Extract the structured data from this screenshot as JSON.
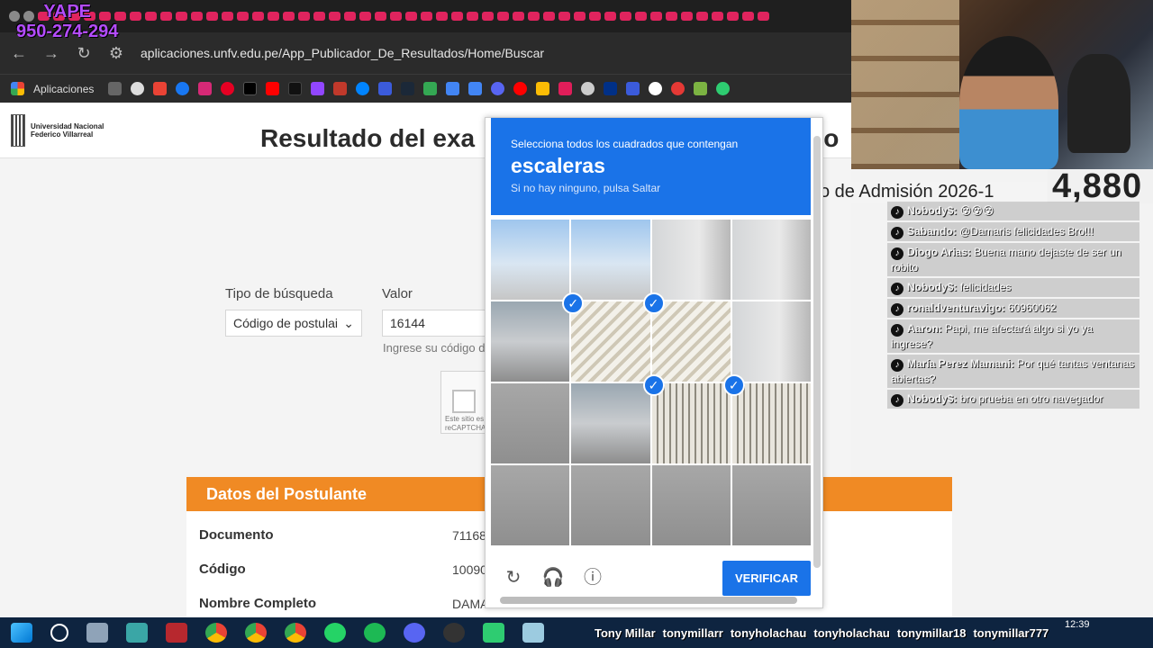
{
  "overlay": {
    "yape_label": "YAPE",
    "yape_number": "950-274-294"
  },
  "browser": {
    "url": "aplicaciones.unfv.edu.pe/App_Publicador_De_Resultados/Home/Buscar",
    "apps_label": "Aplicaciones"
  },
  "page": {
    "logo_line1": "Universidad Nacional",
    "logo_line2": "Federico Villarreal",
    "title_left": "Resultado del exa",
    "title_right": "ario",
    "process_text": "so de Admisión 2026-1",
    "search_type_label": "Tipo de búsqueda",
    "search_type_value": "Código de postulai",
    "value_label": "Valor",
    "value_input": "16144",
    "hint": "Ingrese su código d",
    "recaptcha_small": "Este sitio es reCAPTCHA",
    "section_title": "Datos del Postulante",
    "rows": [
      {
        "label": "Documento",
        "value": "71168"
      },
      {
        "label": "Código",
        "value": "10090"
      },
      {
        "label": "Nombre Completo",
        "value": "DAMA"
      }
    ]
  },
  "captcha": {
    "instruction": "Selecciona todos los cuadrados que contengan",
    "keyword": "escaleras",
    "subtext": "Si no hay ninguno, pulsa Saltar",
    "verify_label": "VERIFICAR",
    "selected_cells": [
      5,
      6,
      10,
      11
    ]
  },
  "stream": {
    "viewer_count": "4,880",
    "chat": [
      {
        "user": "Nobody$:",
        "text": "😵😵😵"
      },
      {
        "user": "Sabando:",
        "text": "@Damaris felicidades Bro!!!"
      },
      {
        "user": "Diogo Arias:",
        "text": "Buena mano dejaste de ser un robito"
      },
      {
        "user": "Nobody$:",
        "text": "felicidades"
      },
      {
        "user": "ronaldventuravigo:",
        "text": "60960062"
      },
      {
        "user": "Aaron:",
        "text": "Papi, me afectará algo si yo ya ingrese?"
      },
      {
        "user": "María Perez Mamani:",
        "text": "Por qué tantas ventanas abiertas?"
      },
      {
        "user": "Nobody$:",
        "text": "bro prueba en otro navegador"
      }
    ],
    "socials": [
      "Tony Millar",
      "tonymillarr",
      "tonyholachau",
      "tonyholachau",
      "tonymillar18",
      "tonymillar777"
    ]
  },
  "taskbar": {
    "time": "12:39"
  }
}
